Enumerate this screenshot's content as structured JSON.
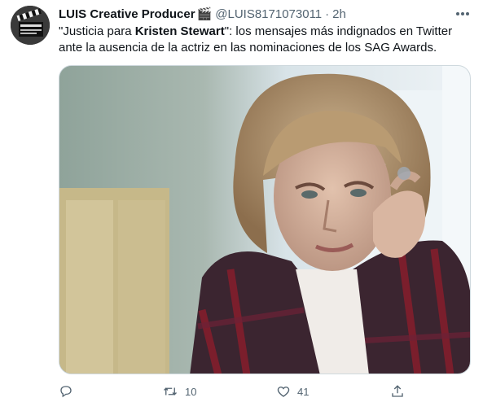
{
  "tweet": {
    "author_name": "LUIS Creative Producer",
    "author_emoji": "🎬",
    "handle": "@LUIS8171073011",
    "separator": "·",
    "time": "2h",
    "text_part1": "\"Justicia para ",
    "text_bold": "Kristen Stewart",
    "text_part2": "\": los mensajes más indignados en Twitter ante la ausencia de la actriz en las nominaciones de los SAG Awards."
  },
  "actions": {
    "reply_count": "",
    "retweet_count": "10",
    "like_count": "41"
  },
  "icons": {
    "more": "more-dots-icon",
    "reply": "reply-icon",
    "retweet": "retweet-icon",
    "like": "heart-icon",
    "share": "share-icon"
  },
  "colors": {
    "text": "#0f1419",
    "secondary": "#536471",
    "border": "#cfd9de"
  }
}
